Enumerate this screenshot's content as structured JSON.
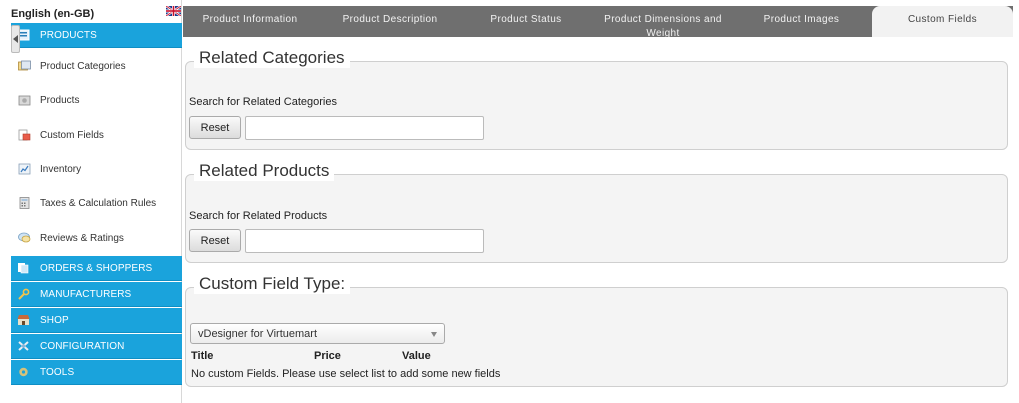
{
  "sidebar": {
    "language": "English (en-GB)",
    "sections": {
      "products": "PRODUCTS",
      "orders": "ORDERS & SHOPPERS",
      "manufacturers": "MANUFACTURERS",
      "shop": "SHOP",
      "configuration": "CONFIGURATION",
      "tools": "TOOLS"
    },
    "items": [
      {
        "label": "Product Categories",
        "icon": "categories-icon"
      },
      {
        "label": "Products",
        "icon": "products-icon"
      },
      {
        "label": "Custom Fields",
        "icon": "custom-fields-icon"
      },
      {
        "label": "Inventory",
        "icon": "inventory-icon"
      },
      {
        "label": "Taxes & Calculation Rules",
        "icon": "taxes-icon"
      },
      {
        "label": "Reviews & Ratings",
        "icon": "reviews-icon"
      }
    ]
  },
  "tabs": [
    {
      "label": "Product Information"
    },
    {
      "label": "Product Description"
    },
    {
      "label": "Product Status"
    },
    {
      "label": "Product Dimensions and Weight"
    },
    {
      "label": "Product Images"
    },
    {
      "label": "Custom Fields"
    }
  ],
  "related_categories": {
    "legend": "Related Categories",
    "search_label": "Search for Related Categories",
    "reset_label": "Reset",
    "value": ""
  },
  "related_products": {
    "legend": "Related Products",
    "search_label": "Search for Related Products",
    "reset_label": "Reset",
    "value": ""
  },
  "custom_field_type": {
    "legend": "Custom Field Type:",
    "selected": "vDesigner for Virtuemart",
    "columns": [
      "Title",
      "Price",
      "Value"
    ],
    "empty_message": "No custom Fields. Please use select list to add some new fields"
  },
  "colors": {
    "accent": "#1aa3dc",
    "tabbar": "#6f6f6f",
    "active_tab": "#f2f2f2"
  }
}
